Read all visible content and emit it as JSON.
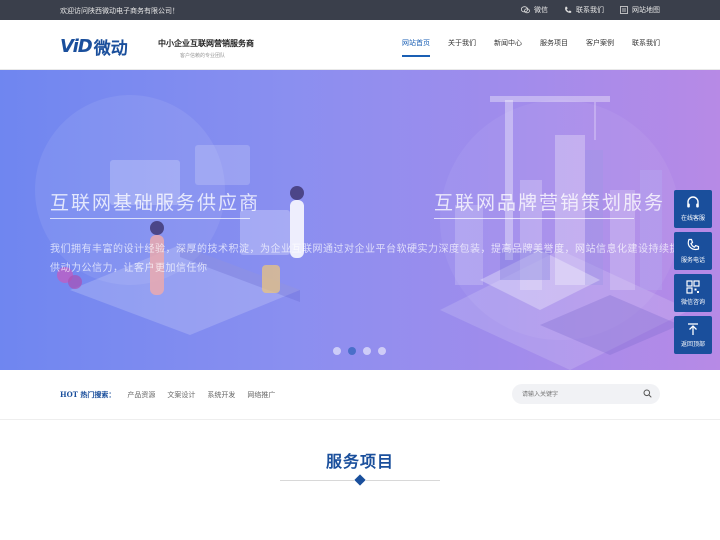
{
  "topbar": {
    "welcome": "欢迎访问陕西微动电子商务有限公司！",
    "links": [
      {
        "icon": "wechat-icon",
        "label": "微信"
      },
      {
        "icon": "phone-icon",
        "label": "联系我们"
      },
      {
        "icon": "sitemap-icon",
        "label": "网站地图"
      }
    ]
  },
  "header": {
    "logo_latin": "ViD",
    "logo_cn": "微动",
    "slogan_main": "中小企业互联网营销服务商",
    "slogan_sub": "客户信赖的专业团队",
    "nav": [
      "网站首页",
      "关于我们",
      "新闻中心",
      "服务项目",
      "客户案例",
      "联系我们"
    ],
    "active_index": 0
  },
  "banner": {
    "title_left": "互联网基础服务供应商",
    "title_right": "互联网品牌营销策划服务",
    "desc": "我们拥有丰富的设计经验，深厚的技术积淀，为企业互联网通过对企业平台软硬实力深度包装，提高品牌美誉度，网站信息化建设持续提供动力公信力，让客户更加信任你",
    "slide_count": 4,
    "active_slide": 1
  },
  "sidetool": [
    {
      "icon": "headset-icon",
      "label": "在线客服"
    },
    {
      "icon": "phone-icon",
      "label": "服务电话"
    },
    {
      "icon": "qrcode-icon",
      "label": "微信咨询"
    },
    {
      "icon": "arrow-up-icon",
      "label": "返回顶部"
    }
  ],
  "hot": {
    "label_hot": "HOT",
    "label_text": "热门搜索：",
    "keywords": [
      "产品资源",
      "文案设计",
      "系统开发",
      "网络推广"
    ]
  },
  "search": {
    "placeholder": "请输入关键字"
  },
  "services": {
    "title": "服务项目"
  },
  "colors": {
    "brand": "#1a4f9c",
    "topbar": "#3a3f4b",
    "banner_start": "#6f86f0",
    "banner_end": "#b78ae6"
  }
}
